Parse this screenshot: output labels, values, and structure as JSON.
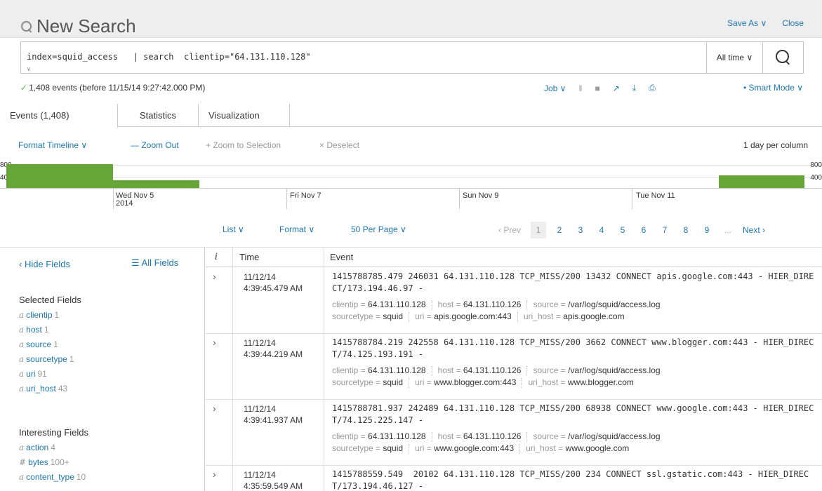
{
  "header": {
    "title": "New Search",
    "save_as": "Save As ∨",
    "close": "Close"
  },
  "search": {
    "query": "index=squid_access   | search  clientip=\"64.131.110.128\"",
    "time_range": "All time ∨"
  },
  "status": {
    "events_text": "1,408 events (before 11/15/14 9:27:42.000 PM)",
    "job": "Job ∨",
    "smart_mode": "Smart Mode ∨"
  },
  "tabs": [
    {
      "label": "Events (1,408)"
    },
    {
      "label": "Statistics"
    },
    {
      "label": "Visualization"
    }
  ],
  "timeline_controls": {
    "format": "Format Timeline ∨",
    "zoom_out": "— Zoom Out",
    "zoom_selection": "+ Zoom to Selection",
    "deselect": "× Deselect",
    "scale": "1 day per column"
  },
  "timeline": {
    "y_labels": [
      "800",
      "400"
    ],
    "dates": [
      {
        "line1": "Wed Nov 5",
        "line2": "2014"
      },
      {
        "line1": "Fri Nov 7",
        "line2": ""
      },
      {
        "line1": "Sun Nov 9",
        "line2": ""
      },
      {
        "line1": "Tue Nov 11",
        "line2": ""
      }
    ]
  },
  "pager_controls": {
    "list": "List ∨",
    "format": "Format ∨",
    "per_page": "50 Per Page ∨",
    "prev": "‹ Prev",
    "pages": [
      "1",
      "2",
      "3",
      "4",
      "5",
      "6",
      "7",
      "8",
      "9"
    ],
    "ellipsis": "...",
    "next": "Next ›"
  },
  "fields_panel": {
    "hide": "‹ Hide Fields",
    "all": "☰ All Fields",
    "selected_title": "Selected Fields",
    "selected": [
      {
        "type": "a",
        "name": "clientip",
        "count": "1"
      },
      {
        "type": "a",
        "name": "host",
        "count": "1"
      },
      {
        "type": "a",
        "name": "source",
        "count": "1"
      },
      {
        "type": "a",
        "name": "sourcetype",
        "count": "1"
      },
      {
        "type": "a",
        "name": "uri",
        "count": "91"
      },
      {
        "type": "a",
        "name": "uri_host",
        "count": "43"
      }
    ],
    "interesting_title": "Interesting Fields",
    "interesting": [
      {
        "type": "a",
        "name": "action",
        "count": "4"
      },
      {
        "type": "#",
        "name": "bytes",
        "count": "100+"
      },
      {
        "type": "a",
        "name": "content_type",
        "count": "10"
      }
    ]
  },
  "events_table": {
    "col_i": "i",
    "col_time": "Time",
    "col_event": "Event",
    "rows": [
      {
        "date": "11/12/14",
        "time": "4:39:45.479 AM",
        "raw": "1415788785.479 246031 64.131.110.128 TCP_MISS/200 13432 CONNECT apis.google.com:443 - HIER_DIRECT/173.194.46.97 -",
        "clientip": "64.131.110.128",
        "host": "64.131.110.126",
        "source": "/var/log/squid/access.log",
        "sourcetype": "squid",
        "uri": "apis.google.com:443",
        "uri_host": "apis.google.com"
      },
      {
        "date": "11/12/14",
        "time": "4:39:44.219 AM",
        "raw": "1415788784.219 242558 64.131.110.128 TCP_MISS/200 3662 CONNECT www.blogger.com:443 - HIER_DIRECT/74.125.193.191 -",
        "clientip": "64.131.110.128",
        "host": "64.131.110.126",
        "source": "/var/log/squid/access.log",
        "sourcetype": "squid",
        "uri": "www.blogger.com:443",
        "uri_host": "www.blogger.com"
      },
      {
        "date": "11/12/14",
        "time": "4:39:41.937 AM",
        "raw": "1415788781.937 242489 64.131.110.128 TCP_MISS/200 68938 CONNECT www.google.com:443 - HIER_DIRECT/74.125.225.147 -",
        "clientip": "64.131.110.128",
        "host": "64.131.110.126",
        "source": "/var/log/squid/access.log",
        "sourcetype": "squid",
        "uri": "www.google.com:443",
        "uri_host": "www.google.com"
      },
      {
        "date": "11/12/14",
        "time": "4:35:59.549 AM",
        "raw": "1415788559.549  20102 64.131.110.128 TCP_MISS/200 234 CONNECT ssl.gstatic.com:443 - HIER_DIRECT/173.194.46.127 -"
      }
    ],
    "field_keys": {
      "clientip": "clientip = ",
      "host": "host = ",
      "source": "source = ",
      "sourcetype": "sourcetype = ",
      "uri": "uri = ",
      "uri_host": "uri_host = "
    }
  },
  "colors": {
    "accent": "#1e76b3",
    "bar": "#65a637",
    "success": "#5cb85c"
  }
}
